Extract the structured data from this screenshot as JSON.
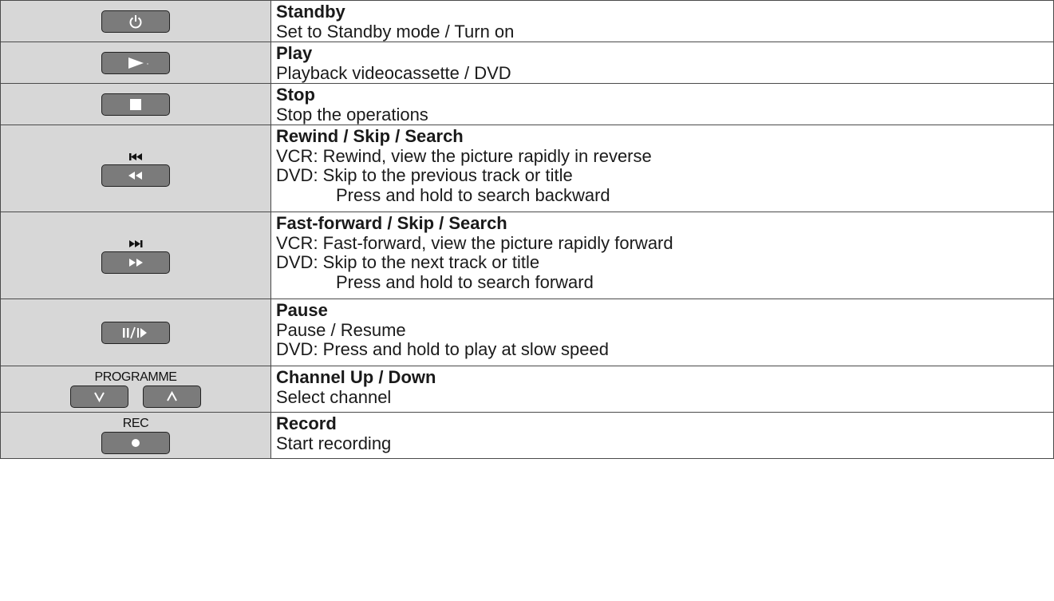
{
  "rows": [
    {
      "key": {
        "icon": "power-icon"
      },
      "title": "Standby",
      "lines": [
        "Set to Standby mode / Turn on"
      ]
    },
    {
      "key": {
        "icon": "play-icon"
      },
      "title": "Play",
      "lines": [
        "Playback videocassette / DVD"
      ]
    },
    {
      "key": {
        "icon": "stop-icon"
      },
      "title": "Stop",
      "lines": [
        "Stop the operations"
      ]
    },
    {
      "key": {
        "icon": "rewind-icon",
        "top_icon": "skip-previous-icon"
      },
      "title": "Rewind / Skip / Search",
      "lines": [
        "VCR: Rewind, view the picture rapidly in reverse",
        "DVD: Skip to the previous track or title",
        "Press and hold to search backward"
      ]
    },
    {
      "key": {
        "icon": "fast-forward-icon",
        "top_icon": "skip-next-icon"
      },
      "title": "Fast-forward / Skip / Search",
      "lines": [
        "VCR: Fast-forward, view the picture rapidly forward",
        "DVD: Skip to the next track or title",
        "Press and hold to search forward"
      ]
    },
    {
      "key": {
        "icon": "pause-slow-icon"
      },
      "title": "Pause",
      "lines": [
        "Pause / Resume",
        "DVD: Press and hold to play at slow speed"
      ]
    },
    {
      "key": {
        "label": "PROGRAMME",
        "icons": [
          "chevron-down-icon",
          "chevron-up-icon"
        ]
      },
      "title": "Channel Up / Down",
      "lines": [
        "Select channel"
      ]
    },
    {
      "key": {
        "label": "REC",
        "icon": "record-icon"
      },
      "title": "Record",
      "lines": [
        "Start recording"
      ]
    }
  ]
}
